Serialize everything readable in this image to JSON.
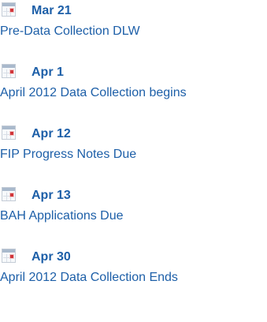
{
  "events": [
    {
      "date": "Mar 21",
      "title": "Pre-Data Collection DLW",
      "icon": "calendar-icon"
    },
    {
      "date": "Apr 1",
      "title": "April 2012 Data Collection begins",
      "icon": "calendar-icon"
    },
    {
      "date": "Apr 12",
      "title": "FIP Progress Notes Due",
      "icon": "calendar-icon"
    },
    {
      "date": "Apr 13",
      "title": "BAH Applications Due",
      "icon": "calendar-icon"
    },
    {
      "date": "Apr 30",
      "title": "April 2012 Data Collection Ends",
      "icon": "calendar-icon"
    }
  ],
  "colors": {
    "link": "#1d5fa8",
    "icon_accent": "#d0353a",
    "icon_header": "#a9b9cc"
  }
}
